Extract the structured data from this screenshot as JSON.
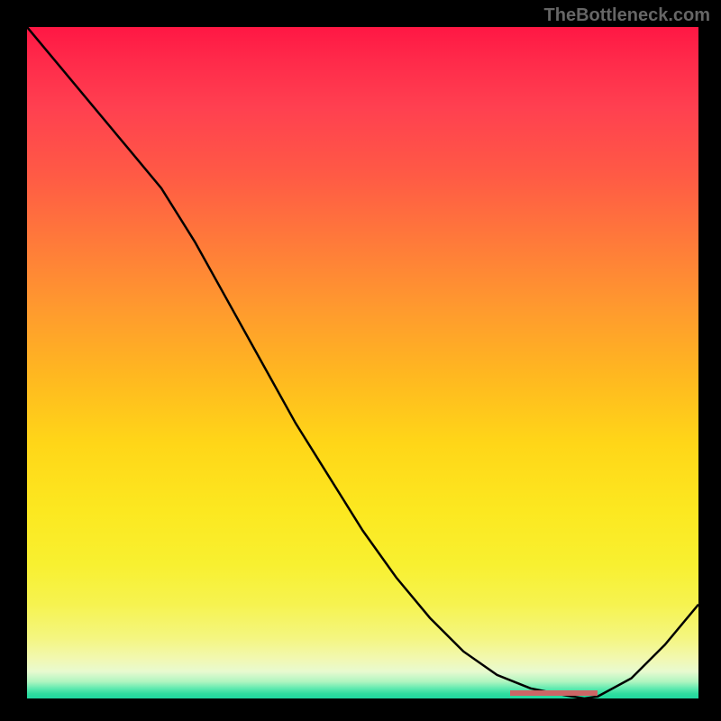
{
  "watermark": "TheBottleneck.com",
  "chart_data": {
    "type": "line",
    "title": "",
    "xlabel": "",
    "ylabel": "",
    "xlim": [
      0,
      100
    ],
    "ylim": [
      0,
      100
    ],
    "grid": false,
    "series": [
      {
        "name": "curve",
        "x": [
          0,
          5,
          10,
          15,
          20,
          25,
          30,
          35,
          40,
          45,
          50,
          55,
          60,
          65,
          70,
          75,
          80,
          83,
          85,
          90,
          95,
          100
        ],
        "y": [
          100,
          94,
          88,
          82,
          76,
          68,
          59,
          50,
          41,
          33,
          25,
          18,
          12,
          7,
          3.5,
          1.5,
          0.5,
          0,
          0.3,
          3,
          8,
          14
        ]
      }
    ],
    "highlight_region": {
      "name": "indicator",
      "x_start": 72,
      "x_end": 85,
      "color": "#cc6666"
    },
    "gradient_stops": [
      {
        "pos": 0,
        "color": "#ff1744"
      },
      {
        "pos": 50,
        "color": "#ffb820"
      },
      {
        "pos": 80,
        "color": "#f8f030"
      },
      {
        "pos": 98,
        "color": "#60eab0"
      },
      {
        "pos": 100,
        "color": "#20d8a0"
      }
    ]
  }
}
